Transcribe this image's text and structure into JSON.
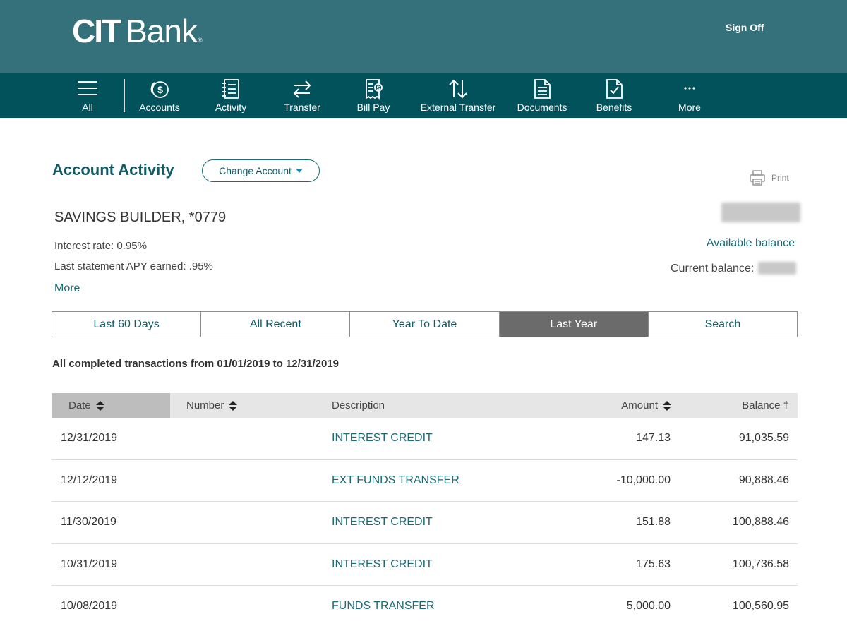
{
  "header": {
    "logo_cit": "CIT",
    "logo_bank": "Bank",
    "logo_reg": "®",
    "sign_off": "Sign Off"
  },
  "nav": [
    {
      "label": "All",
      "icon": "menu-icon"
    },
    {
      "label": "Accounts",
      "icon": "dollar-coin-icon"
    },
    {
      "label": "Activity",
      "icon": "notebook-icon"
    },
    {
      "label": "Transfer",
      "icon": "transfer-arrows-icon"
    },
    {
      "label": "Bill Pay",
      "icon": "bill-icon"
    },
    {
      "label": "External Transfer",
      "icon": "up-down-arrows-icon"
    },
    {
      "label": "Documents",
      "icon": "document-icon"
    },
    {
      "label": "Benefits",
      "icon": "checked-document-icon"
    },
    {
      "label": "More",
      "icon": "ellipsis-icon"
    }
  ],
  "page": {
    "title": "Account Activity",
    "change_account": "Change Account",
    "print": "Print"
  },
  "account": {
    "name": "SAVINGS BUILDER, *0779",
    "interest_rate": "Interest rate: 0.95%",
    "apy": "Last statement APY earned: .95%",
    "more": "More",
    "available_balance": "Available balance",
    "current_balance": "Current balance:"
  },
  "filters": [
    {
      "label": "Last 60 Days",
      "active": false
    },
    {
      "label": "All Recent",
      "active": false
    },
    {
      "label": "Year To Date",
      "active": false
    },
    {
      "label": "Last Year",
      "active": true
    },
    {
      "label": "Search",
      "active": false
    }
  ],
  "range_text": "All completed transactions from 01/01/2019 to 12/31/2019",
  "table": {
    "headers": {
      "date": "Date",
      "number": "Number",
      "description": "Description",
      "amount": "Amount",
      "balance": "Balance †"
    },
    "rows": [
      {
        "date": "12/31/2019",
        "number": "",
        "description": "INTEREST CREDIT",
        "amount": "147.13",
        "balance": "91,035.59"
      },
      {
        "date": "12/12/2019",
        "number": "",
        "description": "EXT FUNDS TRANSFER",
        "amount": "-10,000.00",
        "balance": "90,888.46"
      },
      {
        "date": "11/30/2019",
        "number": "",
        "description": "INTEREST CREDIT",
        "amount": "151.88",
        "balance": "100,888.46"
      },
      {
        "date": "10/31/2019",
        "number": "",
        "description": "INTEREST CREDIT",
        "amount": "175.63",
        "balance": "100,736.58"
      },
      {
        "date": "10/08/2019",
        "number": "",
        "description": "FUNDS TRANSFER",
        "amount": "5,000.00",
        "balance": "100,560.95"
      }
    ]
  },
  "colors": {
    "header_bg": "#34717a",
    "nav_bg": "#02525c",
    "accent": "#0f5c66",
    "active_tab": "#6b6b6b"
  }
}
